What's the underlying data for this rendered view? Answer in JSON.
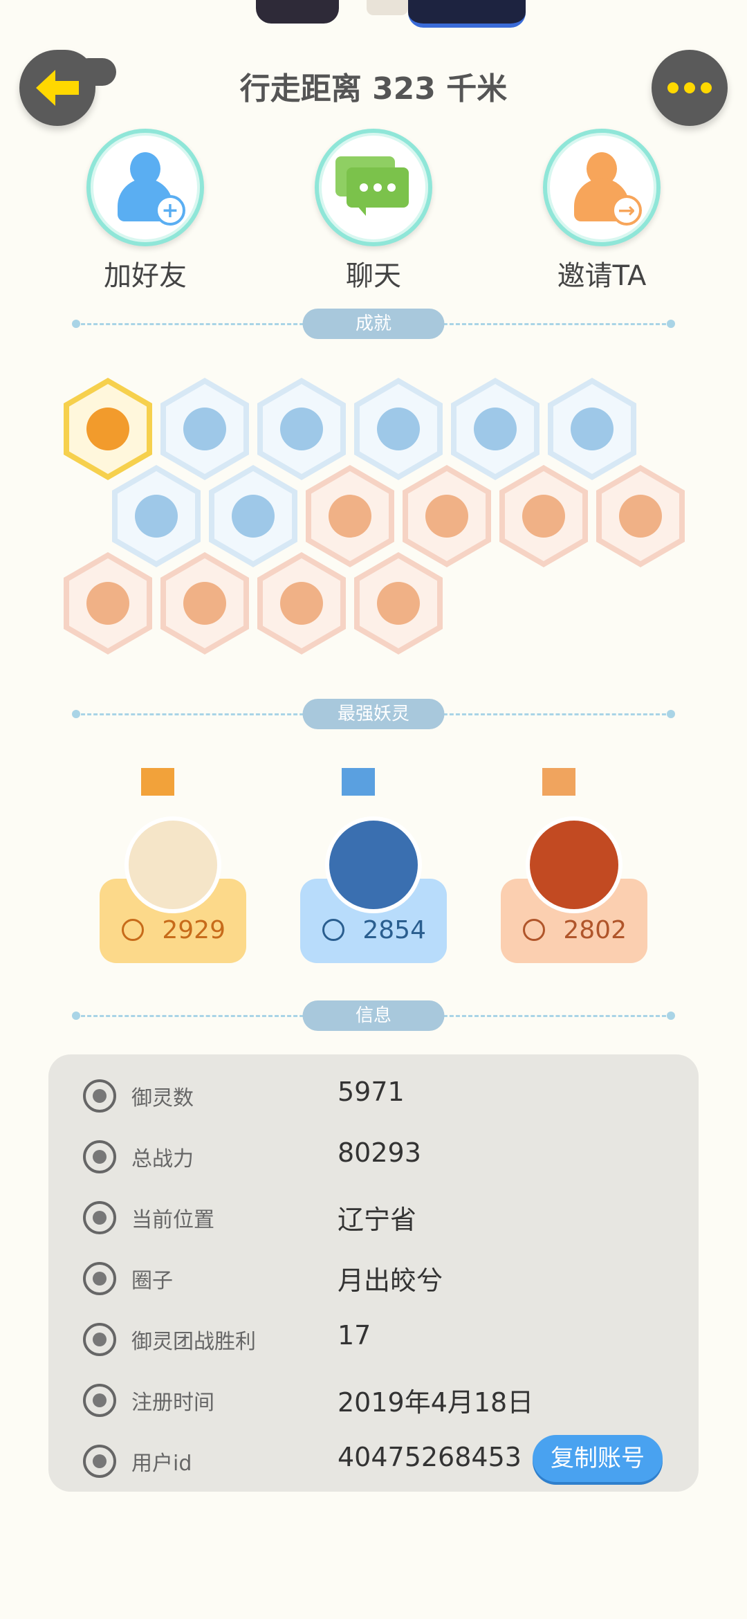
{
  "header": {
    "title": "行走距离 323 千米"
  },
  "actions": [
    {
      "label": "加好友",
      "icon": "add-friend-icon"
    },
    {
      "label": "聊天",
      "icon": "chat-icon"
    },
    {
      "label": "邀请TA",
      "icon": "invite-icon"
    }
  ],
  "sections": {
    "achievements": "成就",
    "strongest": "最强妖灵",
    "info": "信息"
  },
  "achievements": [
    {
      "tier": "gold"
    },
    {
      "tier": "blue"
    },
    {
      "tier": "blue"
    },
    {
      "tier": "blue"
    },
    {
      "tier": "blue"
    },
    {
      "tier": "blue"
    },
    {
      "tier": "blue"
    },
    {
      "tier": "blue"
    },
    {
      "tier": "peach"
    },
    {
      "tier": "peach"
    },
    {
      "tier": "peach"
    },
    {
      "tier": "peach"
    },
    {
      "tier": "peach"
    },
    {
      "tier": "peach"
    },
    {
      "tier": "peach"
    },
    {
      "tier": "peach"
    }
  ],
  "strongest": [
    {
      "power": "2929",
      "color": "#fcd98a",
      "text": "#c76b1a",
      "crown": "#f2a23a",
      "avatar": "#f5e5c8"
    },
    {
      "power": "2854",
      "color": "#b8dcfb",
      "text": "#2a5e8f",
      "crown": "#5aa0e0",
      "avatar": "#3a6fb0"
    },
    {
      "power": "2802",
      "color": "#fbcfb0",
      "text": "#b0552a",
      "crown": "#f0a45e",
      "avatar": "#c24a22"
    }
  ],
  "info": {
    "rows": [
      {
        "key": "御灵数",
        "value": "5971"
      },
      {
        "key": "总战力",
        "value": "80293"
      },
      {
        "key": "当前位置",
        "value": "辽宁省"
      },
      {
        "key": "圈子",
        "value": "月出皎兮"
      },
      {
        "key": "御灵团战胜利",
        "value": "17"
      },
      {
        "key": "注册时间",
        "value": "2019年4月18日"
      },
      {
        "key": "用户id",
        "value": "40475268453"
      }
    ],
    "copy_label": "复制账号"
  },
  "colors": {
    "accent": "#49a2f0",
    "back_arrow": "#ffd800"
  }
}
